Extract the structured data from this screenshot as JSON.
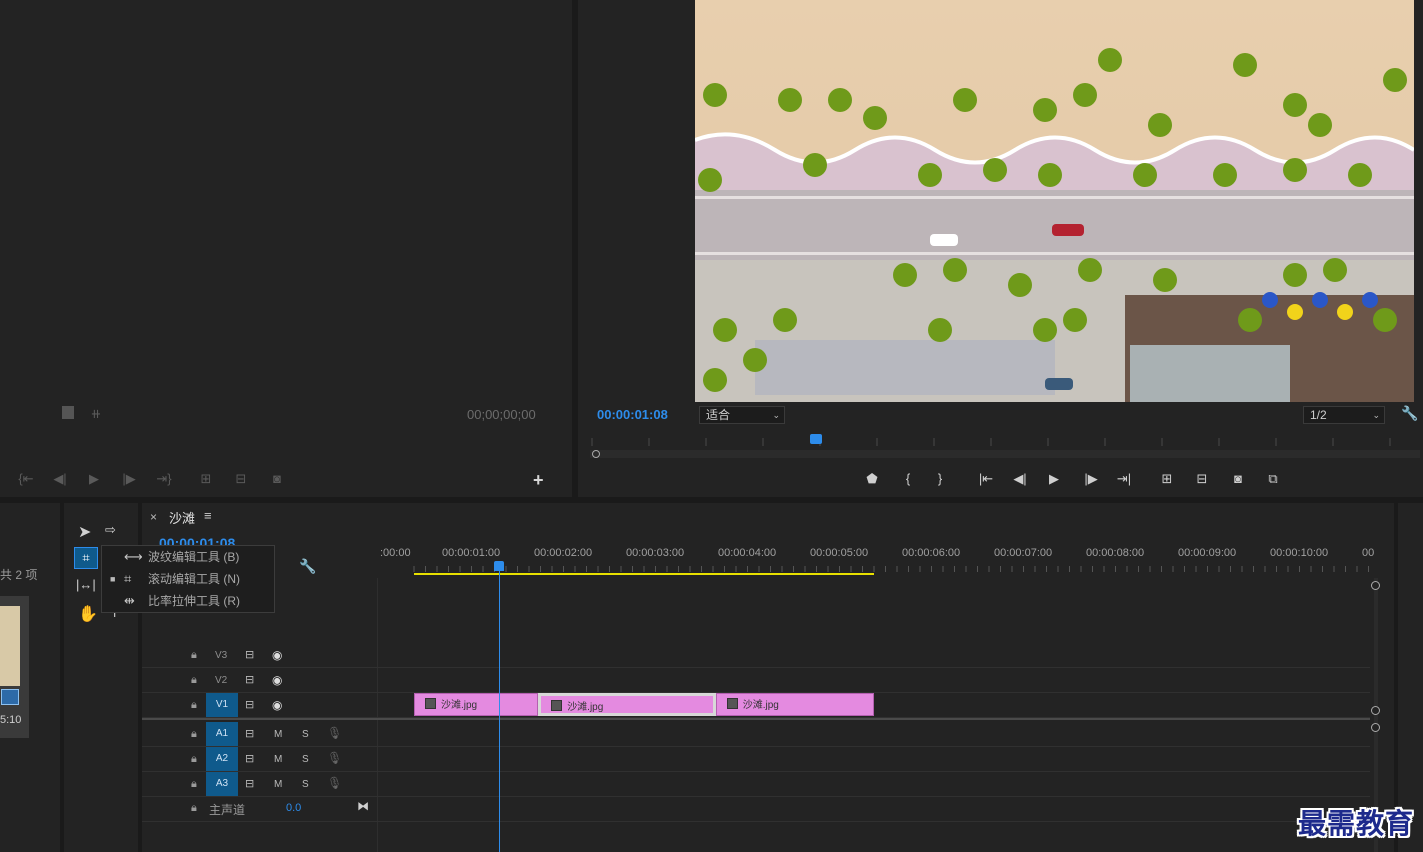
{
  "source_monitor": {
    "timecode": "00;00;00;00",
    "buttons": [
      "mark-in",
      "step-back",
      "play",
      "step-forward",
      "mark-out",
      "insert",
      "overwrite",
      "export-frame"
    ],
    "add_button_label": "+"
  },
  "program_monitor": {
    "timecode": "00:00:01:08",
    "fit_select": "适合",
    "resolution_select": "1/2",
    "playhead_fraction": 0.2,
    "buttons": [
      "add-marker",
      "mark-in",
      "mark-out",
      "go-to-in",
      "step-back",
      "play",
      "step-forward",
      "go-to-out",
      "lift",
      "extract",
      "export-frame",
      "compare"
    ]
  },
  "project": {
    "count_label": "共 2 项",
    "thumb_duration": "5:10"
  },
  "tool_popup": {
    "items": [
      {
        "glyph": "⟷",
        "label": "波纹编辑工具 (B)",
        "active": false
      },
      {
        "glyph": "⌗",
        "label": "滚动编辑工具 (N)",
        "active": true
      },
      {
        "glyph": "⇹",
        "label": "比率拉伸工具 (R)",
        "active": false
      }
    ]
  },
  "timeline": {
    "sequence_name": "沙滩",
    "close_label": "×",
    "menu_label": "≡",
    "playhead_timecode": "00:00:01:08",
    "ruler_labels": [
      ":00:00",
      "00:00:01:00",
      "00:00:02:00",
      "00:00:03:00",
      "00:00:04:00",
      "00:00:05:00",
      "00:00:06:00",
      "00:00:07:00",
      "00:00:08:00",
      "00:00:09:00",
      "00:00:10:00",
      "00"
    ],
    "video_tracks": [
      {
        "name": "V3",
        "targeted": false
      },
      {
        "name": "V2",
        "targeted": false
      },
      {
        "name": "V1",
        "targeted": true
      }
    ],
    "audio_tracks": [
      {
        "name": "A1",
        "m": "M",
        "s": "S"
      },
      {
        "name": "A2",
        "m": "M",
        "s": "S"
      },
      {
        "name": "A3",
        "m": "M",
        "s": "S"
      }
    ],
    "master": {
      "label": "主声道",
      "value": "0.0"
    },
    "clips": [
      {
        "name": "沙滩.jpg",
        "start": 0,
        "end": 1.35
      },
      {
        "name": "沙滩.jpg",
        "start": 1.35,
        "end": 3.28
      },
      {
        "name": "沙滩.jpg",
        "start": 3.28,
        "end": 5.0
      }
    ],
    "work_area_end_seconds": 5.0
  },
  "colors": {
    "accent_blue": "#2d8ceb",
    "clip_pink": "#e48ae0",
    "work_area_yellow": "#e8e000",
    "panel_bg": "#232323"
  },
  "watermark": "最需教育"
}
